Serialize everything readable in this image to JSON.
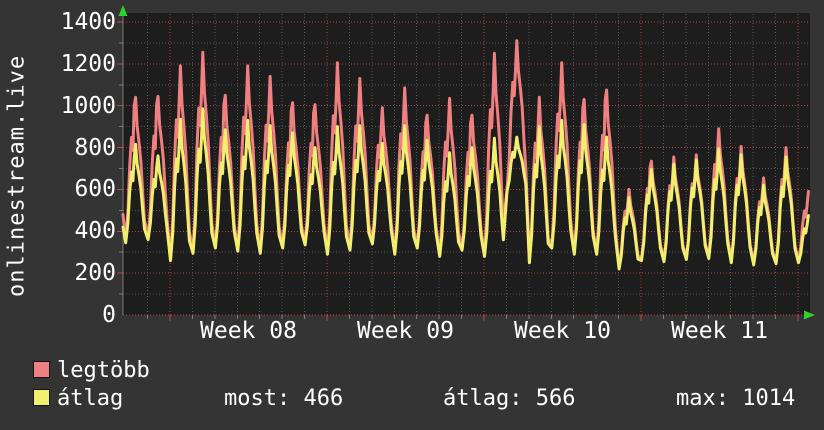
{
  "app": {
    "vertical_title": "onlinestream.live"
  },
  "colors": {
    "page_bg": "#343434",
    "plot_bg": "#1d1d1d",
    "grid_major": "#c24545",
    "grid_minor": "#5a5a5a",
    "axis": "#7a7a7a",
    "arrow": "#2fd12f",
    "text": "#ffffff",
    "legtobb": "#f08080",
    "atlag": "#f1ef6d"
  },
  "legend": {
    "items": [
      {
        "label": "legtöbb",
        "color": "#f08080"
      },
      {
        "label": "átlag",
        "color": "#f1ef6d"
      }
    ]
  },
  "stats": {
    "items": [
      {
        "label": "most",
        "value": "466"
      },
      {
        "label": "átlag",
        "value": "566"
      },
      {
        "label": "max",
        "value": "1014"
      }
    ]
  },
  "chart_data": {
    "type": "line",
    "ylabel": "",
    "xlabel": "",
    "ylim": [
      0,
      1400
    ],
    "y_axis": {
      "min": 0,
      "max": 1400,
      "major_step": 200,
      "minor_step": 100,
      "tick_labels": [
        "0",
        "200",
        "400",
        "600",
        "800",
        "1000",
        "1200",
        "1400"
      ]
    },
    "x_axis": {
      "tick_labels": [
        "Week 08",
        "Week 09",
        "Week 10",
        "Week 11"
      ],
      "days_per_week": 7,
      "first_monday_day": 2.095,
      "total_days": 30.62,
      "grid": true
    },
    "legend_position": "bottom-left",
    "series_meta": [
      {
        "name": "legtöbb",
        "color": "#f08080",
        "role": "daily maximum viewers"
      },
      {
        "name": "átlag",
        "color": "#f1ef6d",
        "role": "daily average viewers"
      }
    ],
    "start_values": {
      "legtobb": 480,
      "atlag": 420
    },
    "days": [
      {
        "night_min": 355,
        "legtobb_peak": 1040,
        "atlag_peak": 815,
        "double_spike": true
      },
      {
        "night_min": 370,
        "legtobb_peak": 1045,
        "atlag_peak": 760,
        "double_spike": true
      },
      {
        "night_min": 270,
        "legtobb_peak": 1190,
        "atlag_peak": 935
      },
      {
        "night_min": 305,
        "legtobb_peak": 1255,
        "atlag_peak": 985
      },
      {
        "night_min": 330,
        "legtobb_peak": 1050,
        "atlag_peak": 885,
        "double_spike": true
      },
      {
        "night_min": 315,
        "legtobb_peak": 1190,
        "atlag_peak": 930
      },
      {
        "night_min": 305,
        "legtobb_peak": 1140,
        "atlag_peak": 905
      },
      {
        "night_min": 330,
        "legtobb_peak": 1015,
        "atlag_peak": 870,
        "double_spike": true
      },
      {
        "night_min": 345,
        "legtobb_peak": 1005,
        "atlag_peak": 800,
        "double_spike": true
      },
      {
        "night_min": 300,
        "legtobb_peak": 1205,
        "atlag_peak": 900
      },
      {
        "night_min": 320,
        "legtobb_peak": 1130,
        "atlag_peak": 905
      },
      {
        "night_min": 350,
        "legtobb_peak": 990,
        "atlag_peak": 820
      },
      {
        "night_min": 300,
        "legtobb_peak": 1085,
        "atlag_peak": 905
      },
      {
        "night_min": 330,
        "legtobb_peak": 955,
        "atlag_peak": 835,
        "double_spike": true
      },
      {
        "night_min": 290,
        "legtobb_peak": 1035,
        "atlag_peak": 775
      },
      {
        "night_min": 320,
        "legtobb_peak": 955,
        "atlag_peak": 800,
        "double_spike": true
      },
      {
        "night_min": 290,
        "legtobb_peak": 1250,
        "atlag_peak": 845
      },
      {
        "night_min": 600,
        "legtobb_peak": 1310,
        "atlag_peak": 850
      },
      {
        "night_min": 260,
        "legtobb_peak": 1040,
        "atlag_peak": 900
      },
      {
        "night_min": 330,
        "legtobb_peak": 1205,
        "atlag_peak": 930
      },
      {
        "night_min": 300,
        "legtobb_peak": 1030,
        "atlag_peak": 910,
        "double_spike": true
      },
      {
        "night_min": 300,
        "legtobb_peak": 1075,
        "atlag_peak": 850,
        "double_spike": true
      },
      {
        "night_min": 230,
        "legtobb_peak": 600,
        "atlag_peak": 560
      },
      {
        "night_min": 270,
        "legtobb_peak": 735,
        "atlag_peak": 695,
        "double_spike": true
      },
      {
        "night_min": 265,
        "legtobb_peak": 755,
        "atlag_peak": 720
      },
      {
        "night_min": 275,
        "legtobb_peak": 765,
        "atlag_peak": 740
      },
      {
        "night_min": 280,
        "legtobb_peak": 890,
        "atlag_peak": 795
      },
      {
        "night_min": 260,
        "legtobb_peak": 805,
        "atlag_peak": 765
      },
      {
        "night_min": 250,
        "legtobb_peak": 655,
        "atlag_peak": 620
      },
      {
        "night_min": 255,
        "legtobb_peak": 800,
        "atlag_peak": 755
      },
      {
        "night_min": 260,
        "legtobb_peak": 590,
        "atlag_peak": 475
      }
    ],
    "stats": {
      "most": 466,
      "atlag": 566,
      "max": 1014
    }
  }
}
